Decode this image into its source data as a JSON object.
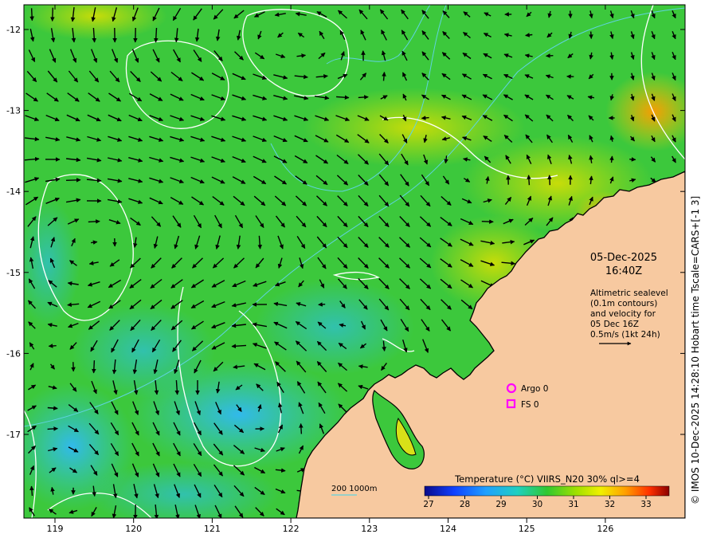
{
  "axes": {
    "lon_ticks": [
      "119",
      "120",
      "121",
      "122",
      "123",
      "124",
      "125",
      "126"
    ],
    "lat_ticks": [
      "-12",
      "-13",
      "-14",
      "-15",
      "-16",
      "-17"
    ]
  },
  "overlay": {
    "date": "05-Dec-2025",
    "time": "16:40Z",
    "desc_lines": [
      "Altimetric sealevel",
      "(0.1m contours)",
      "and velocity for",
      "05 Dec 16Z",
      "0.5m/s (1kt 24h)"
    ]
  },
  "markers": {
    "argo_label": "Argo 0",
    "fs_label": "FS 0"
  },
  "depth_legend": {
    "label": "200  1000m"
  },
  "colorbar": {
    "title": "Temperature (°C) VIIRS_N20 30% ql>=4",
    "ticks": [
      "27",
      "28",
      "29",
      "30",
      "31",
      "32",
      "33"
    ]
  },
  "credit": "© IMOS 10-Dec-2025 14:28:10 Hobart time Tscale=CARS+[-1 3]",
  "colors": {
    "land": "#f7c9a0",
    "coast": "#000000",
    "contour": "#ffffff",
    "isobath": "#5fd3e0",
    "marker": "#ff00ff"
  }
}
